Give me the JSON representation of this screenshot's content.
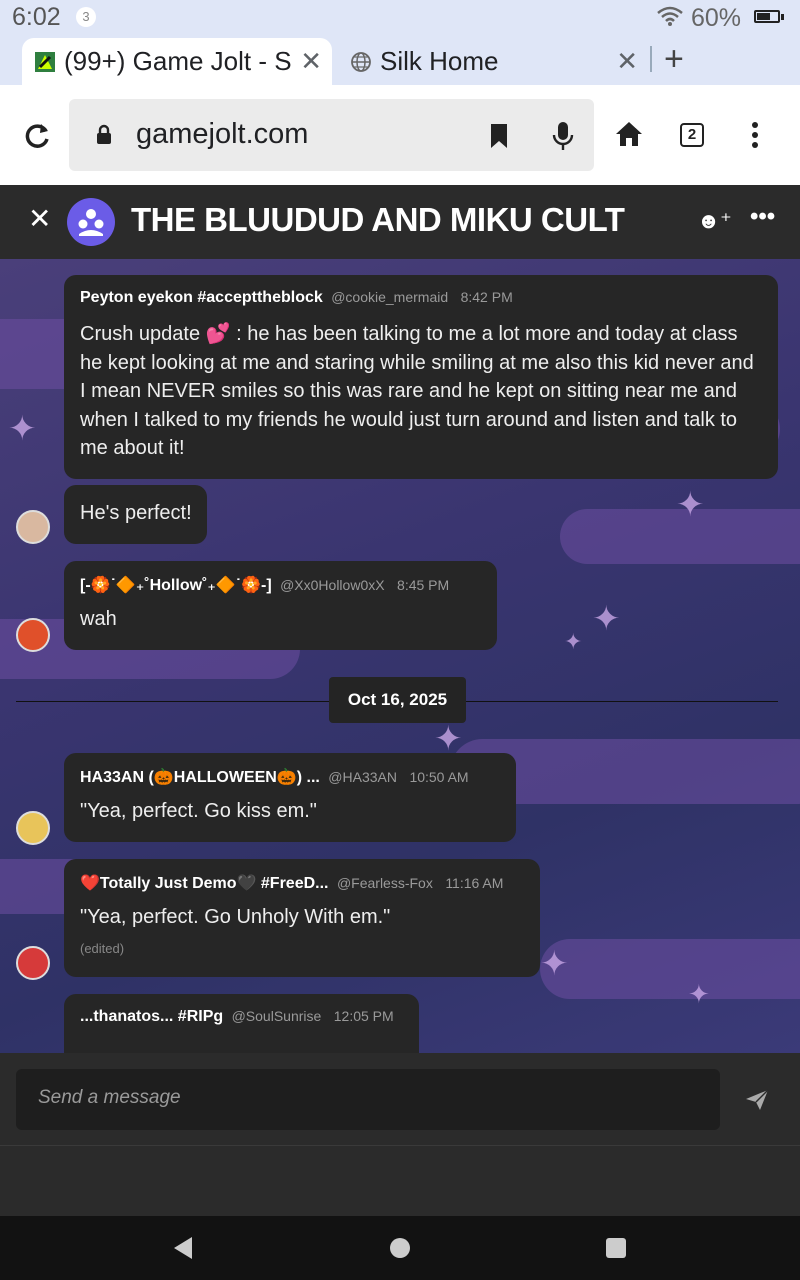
{
  "status_bar": {
    "time": "6:02",
    "notification_count": "3",
    "battery": "60%"
  },
  "tabs": [
    {
      "title": "(99+) Game Jolt - S",
      "active": true
    },
    {
      "title": "Silk Home",
      "active": false
    }
  ],
  "toolbar": {
    "url": "gamejolt.com",
    "tab_count": "2"
  },
  "chat": {
    "title": "THE BLUUDUD AND MIKU CULT",
    "date_divider": "Oct 16, 2025",
    "messages": [
      {
        "name": "Peyton eyekon #accepttheblock",
        "handle": "@cookie_mermaid",
        "time": "8:42 PM",
        "lines": [
          "Crush  update  💕 : he has been talking to me a lot more and today at class",
          "he kept looking at me and staring while smiling at me also this kid never and",
          "I mean NEVER smiles so this was rare and he kept on sitting near me and",
          "when I talked to my friends he would just turn around and listen and talk to",
          "me about it!"
        ]
      },
      {
        "lines": [
          "He's perfect!"
        ]
      },
      {
        "name": "[-🏵️˙🔶₊˚Hollow˚₊🔶˙🏵️-]",
        "handle": "@Xx0Hollow0xX",
        "time": "8:45 PM",
        "lines": [
          "wah"
        ]
      },
      {
        "name": "HA33AN (🎃HALLOWEEN🎃) ...",
        "handle": "@HA33AN",
        "time": "10:50 AM",
        "lines": [
          "\"Yea, perfect. Go kiss em.\""
        ]
      },
      {
        "name": "❤️Totally Just Demo🖤 #FreeD...",
        "handle": "@Fearless-Fox",
        "time": "11:16 AM",
        "lines": [
          "\"Yea, perfect. Go Unholy With em.\""
        ],
        "edited": "(edited)"
      },
      {
        "name": "...thanatos... #RIPg",
        "handle": "@SoulSunrise",
        "time": "12:05 PM",
        "lines": []
      }
    ]
  },
  "composer": {
    "placeholder": "Send a message"
  },
  "colors": {
    "header_bg": "#2b2b2b",
    "bubble_bg": "#262626",
    "avatar_purple": "#6b5ce7"
  }
}
